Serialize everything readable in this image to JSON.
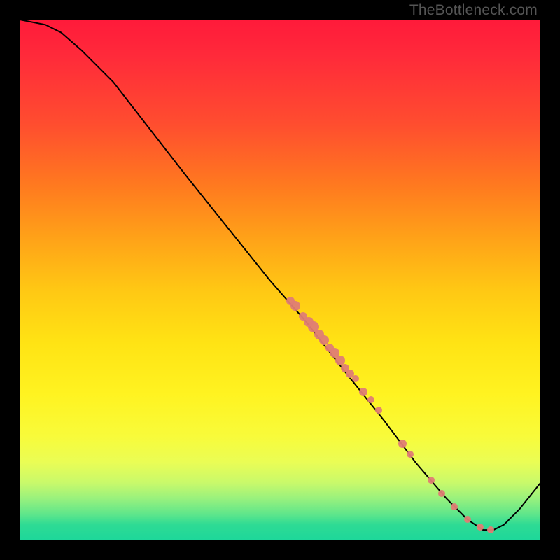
{
  "watermark": "TheBottleneck.com",
  "colors": {
    "dot": "#df7d74",
    "line": "#000000"
  },
  "chart_data": {
    "type": "line",
    "title": "",
    "xlabel": "",
    "ylabel": "",
    "xlim": [
      0,
      100
    ],
    "ylim": [
      0,
      100
    ],
    "curve": [
      {
        "x": 0,
        "y": 100
      },
      {
        "x": 5,
        "y": 99
      },
      {
        "x": 8,
        "y": 97.5
      },
      {
        "x": 12,
        "y": 94
      },
      {
        "x": 18,
        "y": 88
      },
      {
        "x": 25,
        "y": 79
      },
      {
        "x": 32,
        "y": 70
      },
      {
        "x": 40,
        "y": 60
      },
      {
        "x": 48,
        "y": 50
      },
      {
        "x": 55,
        "y": 42
      },
      {
        "x": 62,
        "y": 33
      },
      {
        "x": 70,
        "y": 23
      },
      {
        "x": 76,
        "y": 15
      },
      {
        "x": 82,
        "y": 8
      },
      {
        "x": 86,
        "y": 4
      },
      {
        "x": 89,
        "y": 2
      },
      {
        "x": 91,
        "y": 2
      },
      {
        "x": 93,
        "y": 3
      },
      {
        "x": 96,
        "y": 6
      },
      {
        "x": 100,
        "y": 11
      }
    ],
    "points": [
      {
        "x": 52,
        "y": 46,
        "r": 6
      },
      {
        "x": 53,
        "y": 45,
        "r": 7
      },
      {
        "x": 54.5,
        "y": 43,
        "r": 6
      },
      {
        "x": 55.5,
        "y": 42,
        "r": 7
      },
      {
        "x": 56.5,
        "y": 41,
        "r": 8
      },
      {
        "x": 57.5,
        "y": 39.5,
        "r": 7
      },
      {
        "x": 58.5,
        "y": 38.5,
        "r": 7
      },
      {
        "x": 59.5,
        "y": 37,
        "r": 6
      },
      {
        "x": 60.5,
        "y": 36,
        "r": 7
      },
      {
        "x": 61.5,
        "y": 34.5,
        "r": 7
      },
      {
        "x": 62.5,
        "y": 33,
        "r": 6
      },
      {
        "x": 63.5,
        "y": 32,
        "r": 6
      },
      {
        "x": 64.5,
        "y": 31,
        "r": 5
      },
      {
        "x": 66,
        "y": 28.5,
        "r": 6
      },
      {
        "x": 67.5,
        "y": 27,
        "r": 5
      },
      {
        "x": 69,
        "y": 25,
        "r": 5
      },
      {
        "x": 73.5,
        "y": 18.5,
        "r": 6
      },
      {
        "x": 75,
        "y": 16.5,
        "r": 5
      },
      {
        "x": 79,
        "y": 11.5,
        "r": 5
      },
      {
        "x": 81,
        "y": 9,
        "r": 5
      },
      {
        "x": 83.5,
        "y": 6.5,
        "r": 5
      },
      {
        "x": 86,
        "y": 4,
        "r": 5
      },
      {
        "x": 88.5,
        "y": 2.5,
        "r": 5
      },
      {
        "x": 90.5,
        "y": 2,
        "r": 5
      }
    ]
  }
}
